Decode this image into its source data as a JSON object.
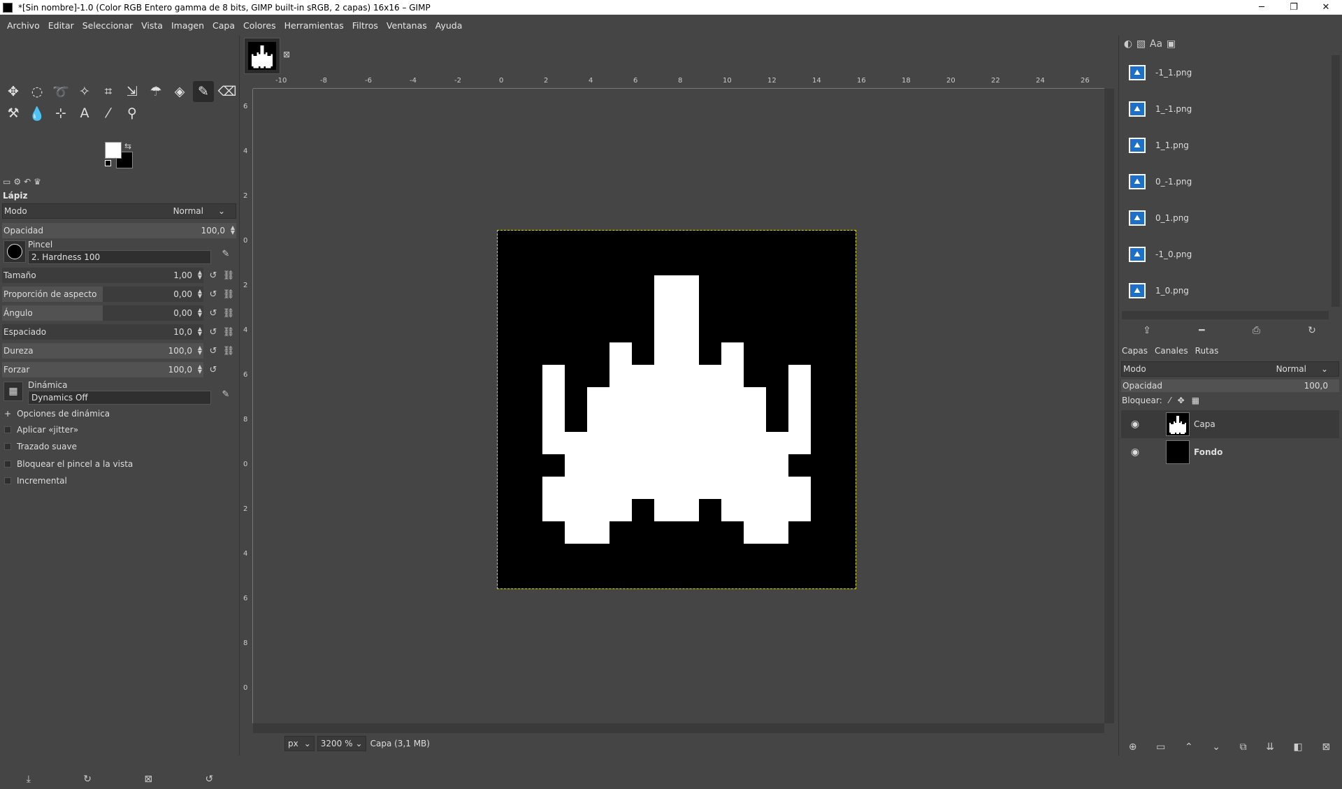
{
  "window": {
    "title": "*[Sin nombre]-1.0 (Color RGB Entero gamma de 8 bits, GIMP built-in sRGB, 2 capas) 16x16 – GIMP",
    "minimize": "─",
    "maximize": "❐",
    "close": "✕"
  },
  "menu": [
    "Archivo",
    "Editar",
    "Seleccionar",
    "Vista",
    "Imagen",
    "Capa",
    "Colores",
    "Herramientas",
    "Filtros",
    "Ventanas",
    "Ayuda"
  ],
  "tool_options": {
    "title": "Lápiz",
    "mode_label": "Modo",
    "mode_value": "Normal",
    "opacity_label": "Opacidad",
    "opacity_value": "100,0",
    "brush_label": "Pincel",
    "brush_value": "2. Hardness 100",
    "sliders": [
      {
        "label": "Tamaño",
        "value": "1,00",
        "fill": 0.0
      },
      {
        "label": "Proporción de aspecto",
        "value": "0,00",
        "fill": 0.5
      },
      {
        "label": "Ángulo",
        "value": "0,00",
        "fill": 0.5
      },
      {
        "label": "Espaciado",
        "value": "10,0",
        "fill": 0.0
      },
      {
        "label": "Dureza",
        "value": "100,0",
        "fill": 1.0
      },
      {
        "label": "Forzar",
        "value": "100,0",
        "fill": 1.0
      }
    ],
    "dynamics_label": "Dinámica",
    "dynamics_value": "Dynamics Off",
    "options": [
      "Opciones de dinámica",
      "Aplicar «jitter»",
      "Trazado suave",
      "Bloquear el pincel a la vista",
      "Incremental"
    ]
  },
  "ruler_h": [
    "-10",
    "-8",
    "-6",
    "-4",
    "-2",
    "0",
    "2",
    "4",
    "6",
    "8",
    "10",
    "12",
    "14",
    "16",
    "18",
    "20",
    "22",
    "24",
    "26"
  ],
  "ruler_v": [
    "6",
    "4",
    "2",
    "0",
    "2",
    "4",
    "6",
    "8",
    "0",
    "2",
    "4",
    "6",
    "8",
    "0"
  ],
  "status": {
    "unit": "px",
    "zoom": "3200 %",
    "layer_info": "Capa (3,1 MB)"
  },
  "images_panel": {
    "items": [
      "-1_1.png",
      "1_-1.png",
      "1_1.png",
      "0_-1.png",
      "0_1.png",
      "-1_0.png",
      "1_0.png"
    ]
  },
  "layers_panel": {
    "tabs": [
      "Capas",
      "Canales",
      "Rutas"
    ],
    "mode_label": "Modo",
    "mode_value": "Normal",
    "opacity_label": "Opacidad",
    "opacity_value": "100,0",
    "lock_label": "Bloquear:",
    "layers": [
      {
        "name": "Capa"
      },
      {
        "name": "Fondo"
      }
    ]
  }
}
